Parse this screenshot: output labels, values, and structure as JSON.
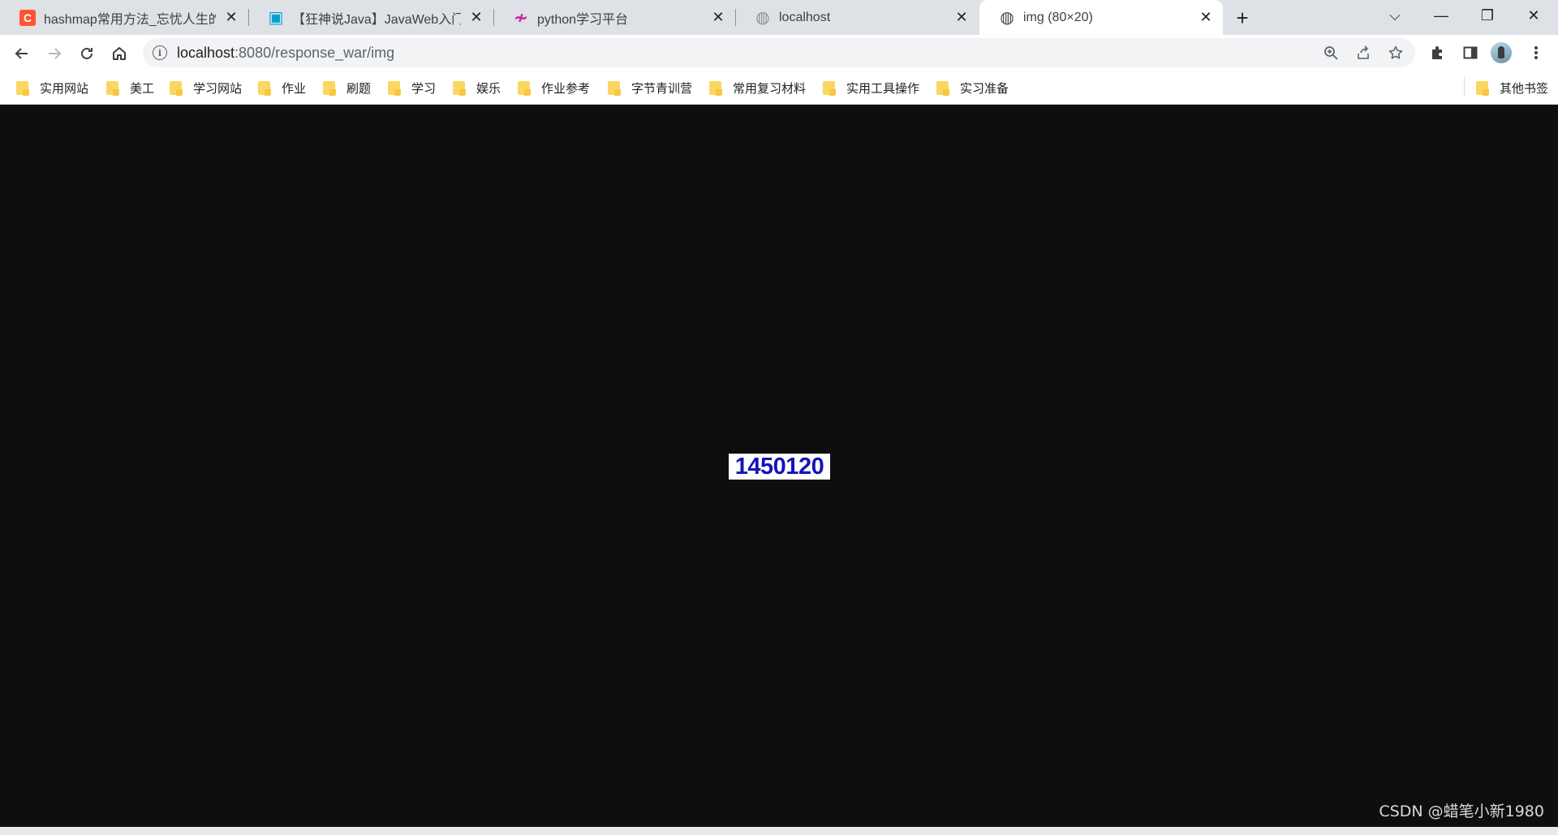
{
  "tabs": [
    {
      "title": "hashmap常用方法_忘忧人生的博",
      "favicon": "csdn-icon",
      "favicon_glyph": "C",
      "favicon_color": "#fc5531",
      "active": false
    },
    {
      "title": "【狂神说Java】JavaWeb入门到实",
      "favicon": "bilibili-icon",
      "favicon_glyph": "▣",
      "favicon_color": "#00a1d6",
      "active": false
    },
    {
      "title": "python学习平台",
      "favicon": "python-platform-icon",
      "favicon_glyph": "≁",
      "favicon_color": "#c9259a",
      "active": false
    },
    {
      "title": "localhost",
      "favicon": "globe-icon",
      "favicon_glyph": "◍",
      "favicon_color": "#8a8d91",
      "active": false
    },
    {
      "title": "img (80×20)",
      "favicon": "globe-icon",
      "favicon_glyph": "◍",
      "favicon_color": "#3c4043",
      "active": true
    }
  ],
  "new_tab_label": "+",
  "window_controls": {
    "dropdown": "⌵",
    "minimize": "—",
    "restore": "❐",
    "close": "✕"
  },
  "address": {
    "host": "localhost",
    "path": ":8080/response_war/img"
  },
  "bookmarks": [
    "实用网站",
    "美工",
    "学习网站",
    "作业",
    "刷题",
    "学习",
    "娱乐",
    "作业参考",
    "字节青训营",
    "常用复习材料",
    "实用工具操作",
    "实习准备"
  ],
  "other_bookmarks": "其他书签",
  "image_text": "1450120",
  "watermark": "CSDN @蜡笔小新1980",
  "colors": {
    "tabstrip": "#dee1e6",
    "content_bg": "#0e0e0e",
    "image_text": "#1414b8",
    "folder": "#fbd762"
  }
}
